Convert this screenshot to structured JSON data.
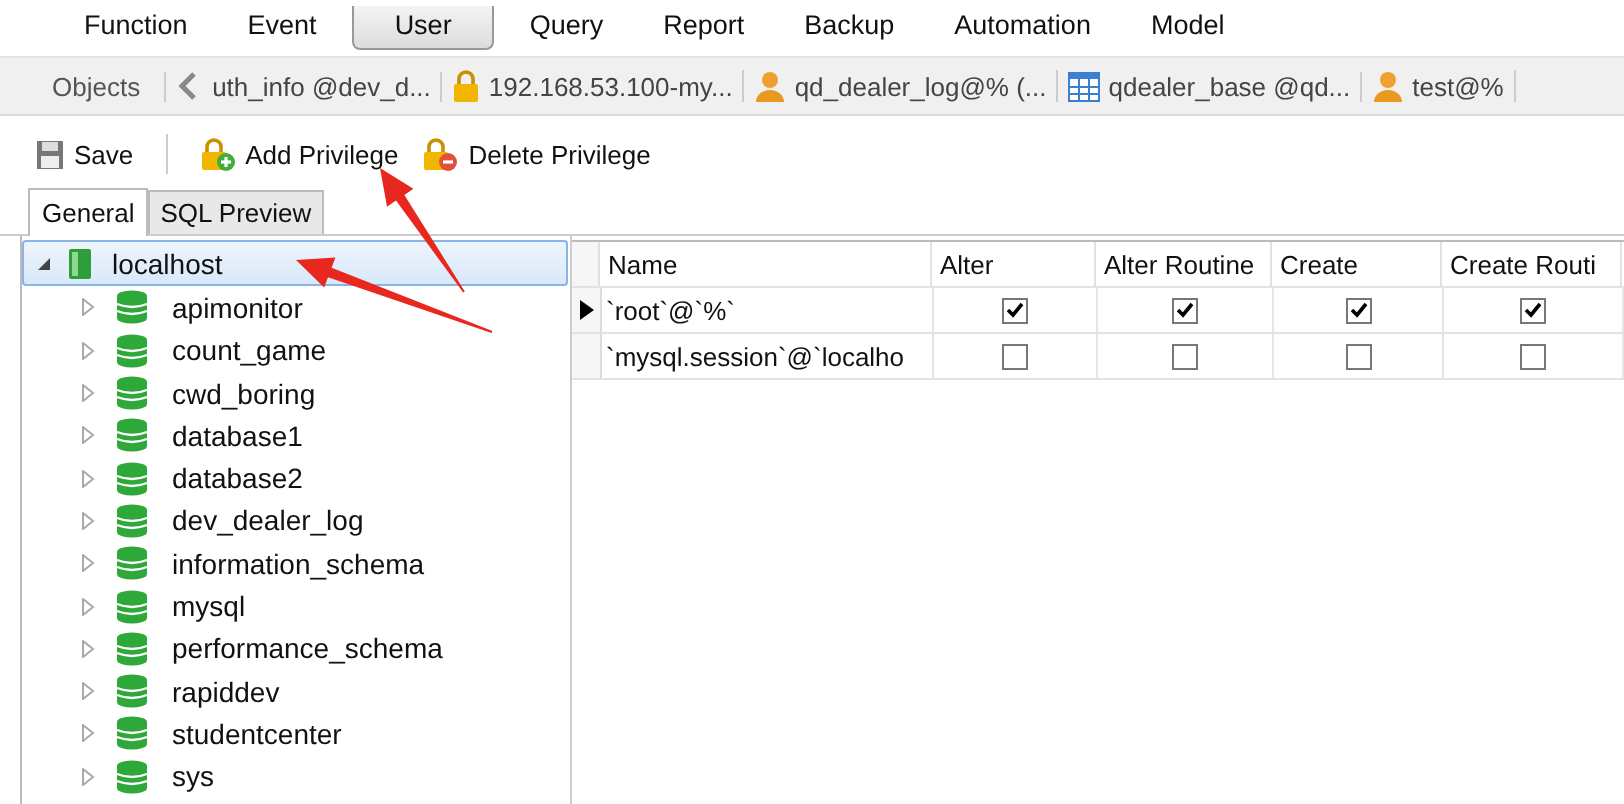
{
  "menu": [
    {
      "label": "Function",
      "selected": false
    },
    {
      "label": "Event",
      "selected": false
    },
    {
      "label": "User",
      "selected": true
    },
    {
      "label": "Query",
      "selected": false
    },
    {
      "label": "Report",
      "selected": false
    },
    {
      "label": "Backup",
      "selected": false
    },
    {
      "label": "Automation",
      "selected": false
    },
    {
      "label": "Model",
      "selected": false
    }
  ],
  "object_tabs": {
    "objects_label": "Objects",
    "tabs": [
      {
        "kind": "plain",
        "label": "uth_info @dev_d..."
      },
      {
        "kind": "lock",
        "label": "192.168.53.100-my..."
      },
      {
        "kind": "user",
        "label": "qd_dealer_log@% (..."
      },
      {
        "kind": "table",
        "label": "qdealer_base @qd..."
      },
      {
        "kind": "user",
        "label": "test@%"
      }
    ]
  },
  "toolbar": [
    {
      "kind": "save",
      "label": "Save"
    },
    {
      "kind": "add",
      "label": "Add Privilege"
    },
    {
      "kind": "delete",
      "label": "Delete Privilege"
    }
  ],
  "sub_tabs": [
    {
      "label": "General",
      "selected": true
    },
    {
      "label": "SQL Preview",
      "selected": false
    }
  ],
  "tree": {
    "label": "localhost",
    "expanded": true,
    "selected": true,
    "children": [
      {
        "label": "apimonitor",
        "expanded": false
      },
      {
        "label": "count_game",
        "expanded": false
      },
      {
        "label": "cwd_boring",
        "expanded": false
      },
      {
        "label": "database1",
        "expanded": false
      },
      {
        "label": "database2",
        "expanded": false
      },
      {
        "label": "dev_dealer_log",
        "expanded": false
      },
      {
        "label": "information_schema",
        "expanded": false
      },
      {
        "label": "mysql",
        "expanded": false
      },
      {
        "label": "performance_schema",
        "expanded": false
      },
      {
        "label": "rapiddev",
        "expanded": false
      },
      {
        "label": "studentcenter",
        "expanded": false
      },
      {
        "label": "sys",
        "expanded": false
      }
    ]
  },
  "table": {
    "columns": [
      "Name",
      "Alter",
      "Alter Routine",
      "Create",
      "Create Routi"
    ],
    "rows": [
      {
        "current": true,
        "name": "`root`@`%`",
        "privileges": [
          true,
          true,
          true,
          true
        ]
      },
      {
        "current": false,
        "name": "`mysql.session`@`localho",
        "privileges": [
          false,
          false,
          false,
          false
        ]
      }
    ]
  },
  "annotations": [
    {
      "kind": "arrow"
    },
    {
      "kind": "arrow"
    }
  ]
}
